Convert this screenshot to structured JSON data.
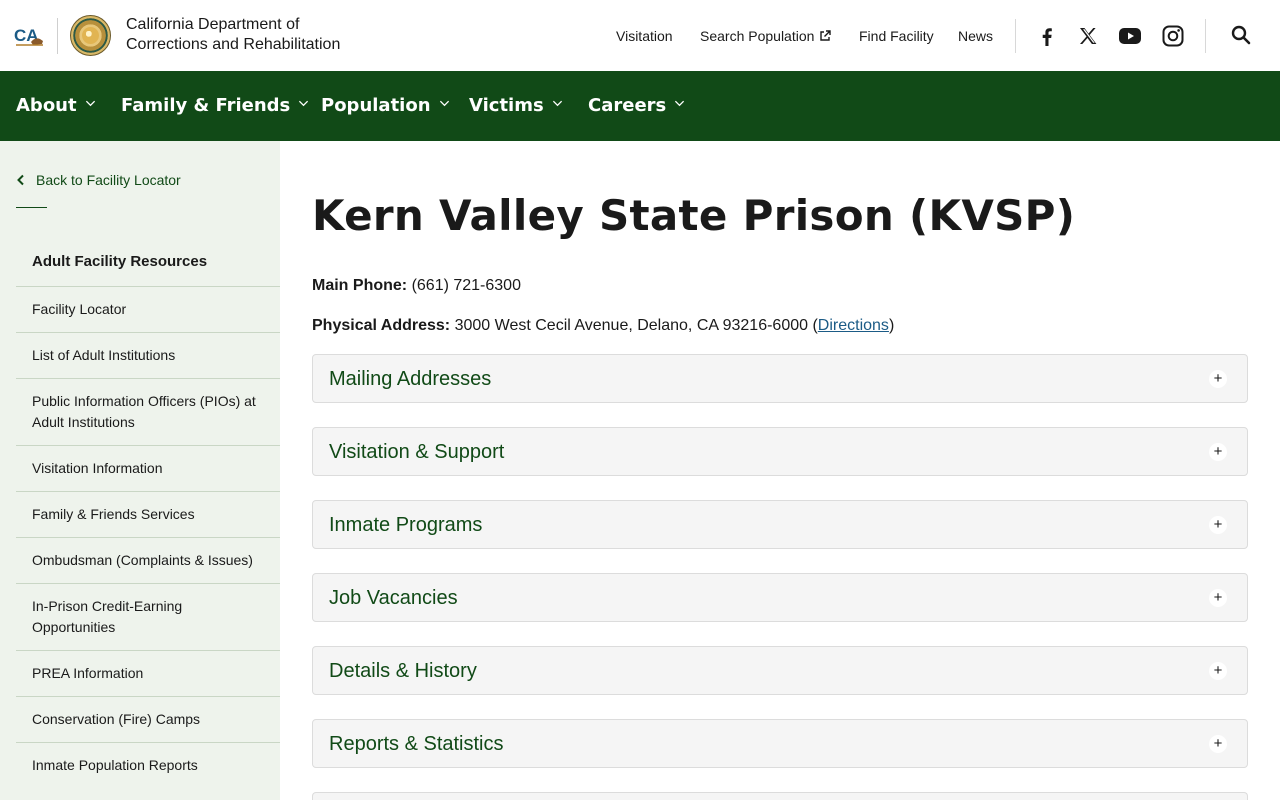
{
  "header": {
    "ca_logo_text": "CA",
    "dept_name_line1": "California Department of",
    "dept_name_line2": "Corrections and Rehabilitation",
    "links": [
      "Visitation",
      "Search Population",
      "Find Facility",
      "News"
    ],
    "social_icons": [
      "facebook-icon",
      "x-icon",
      "youtube-icon",
      "instagram-icon"
    ],
    "search_icon": "search-icon"
  },
  "mainnav": {
    "items": [
      "About",
      "Family & Friends",
      "Population",
      "Victims",
      "Careers"
    ]
  },
  "sidebar": {
    "back_link": "Back to Facility Locator",
    "heading": "Adult Facility Resources",
    "items": [
      "Facility Locator",
      "List of Adult Institutions",
      "Public Information Officers (PIOs) at Adult Institutions",
      "Visitation Information",
      "Family & Friends Services",
      "Ombudsman (Complaints & Issues)",
      "In-Prison Credit-Earning Opportunities",
      "PREA Information",
      "Conservation (Fire) Camps",
      "Inmate Population Reports"
    ]
  },
  "main": {
    "title": "Kern Valley State Prison (KVSP)",
    "phone_label": "Main Phone:",
    "phone_value": "(661) 721-6300",
    "address_label": "Physical Address:",
    "address_value": "3000 West Cecil Avenue, Delano, CA 93216-6000 (",
    "directions_link": "Directions",
    "address_close": ")",
    "accordions": [
      "Mailing Addresses",
      "Visitation & Support",
      "Inmate Programs",
      "Job Vacancies",
      "Details & History",
      "Reports & Statistics"
    ],
    "accordion_toggle": "+"
  },
  "colors": {
    "brand_green": "#114a17",
    "sidebar_bg": "#eef3ec",
    "link_blue": "#1b5b86"
  }
}
